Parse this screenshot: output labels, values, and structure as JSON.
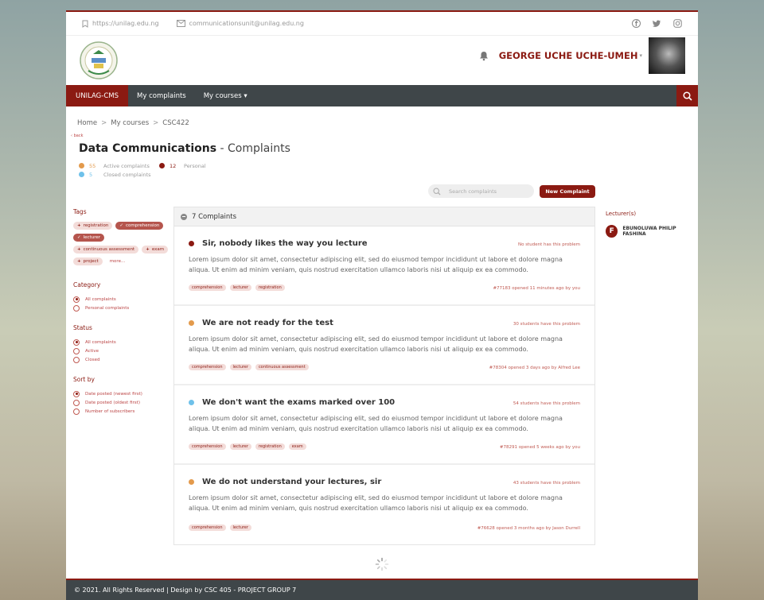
{
  "topbar": {
    "website": "https://unilag.edu.ng",
    "email": "communicationsunit@unilag.edu.ng",
    "social_icons": [
      "facebook-icon",
      "twitter-icon",
      "instagram-icon"
    ]
  },
  "user": {
    "name": "GEORGE UCHE UCHE-UMEH",
    "caret": "▾"
  },
  "nav": {
    "brand": "UNILAG-CMS",
    "links": [
      "My complaints",
      "My courses ▾"
    ]
  },
  "breadcrumb": {
    "items": [
      "Home",
      "My courses",
      "CSC422"
    ],
    "sep": ">"
  },
  "back": "‹ back",
  "page": {
    "course": "Data Communications",
    "section": " - Complaints"
  },
  "stats": {
    "active_count": "55",
    "active_label": "Active complaints",
    "personal_count": "12",
    "personal_label": "Personal",
    "closed_count": "5",
    "closed_label": "Closed complaints"
  },
  "toolbar": {
    "search_placeholder": "Search complaints",
    "new_label": "New Complaint"
  },
  "filters": {
    "tags_title": "Tags",
    "tags": [
      {
        "label": "registration",
        "prefix": "+",
        "active": false
      },
      {
        "label": "comprehension",
        "prefix": "✓",
        "active": true
      },
      {
        "label": "lecturer",
        "prefix": "✓",
        "active": true
      },
      {
        "label": "continuous assessment",
        "prefix": "+",
        "active": false
      },
      {
        "label": "exam",
        "prefix": "+",
        "active": false
      },
      {
        "label": "project",
        "prefix": "+",
        "active": false
      }
    ],
    "more": "more...",
    "category_title": "Category",
    "category": [
      "All complaints",
      "Personal complaints"
    ],
    "status_title": "Status",
    "status": [
      "All complaints",
      "Active",
      "Closed"
    ],
    "sort_title": "Sort by",
    "sort": [
      "Date posted (newest first)",
      "Date posted (oldest first)",
      "Number of subscribers"
    ]
  },
  "list": {
    "count_label": "7 Complaints",
    "items": [
      {
        "title": "Sir, nobody likes the way you lecture",
        "status_color": "#8b1a12",
        "subscribers": "No student has this problem",
        "body": "Lorem ipsum dolor sit amet, consectetur adipiscing elit, sed do eiusmod tempor incididunt ut labore et dolore magna aliqua. Ut enim ad minim veniam, quis nostrud exercitation ullamco laboris nisi ut aliquip ex ea commodo.",
        "tags": [
          "comprehension",
          "lecturer",
          "registration"
        ],
        "meta": "#77183 opened 11 minutes ago by you"
      },
      {
        "title": "We are not ready for the test",
        "status_color": "#e39a4c",
        "subscribers": "30 students have this problem",
        "body": "Lorem ipsum dolor sit amet, consectetur adipiscing elit, sed do eiusmod tempor incididunt ut labore et dolore magna aliqua. Ut enim ad minim veniam, quis nostrud exercitation ullamco laboris nisi ut aliquip ex ea commodo.",
        "tags": [
          "comprehension",
          "lecturer",
          "continuous assessment"
        ],
        "meta": "#78304 opened 3 days ago by Alfred Lee"
      },
      {
        "title": "We don't want the exams marked over 100",
        "status_color": "#6fc1ea",
        "subscribers": "54 students have this problem",
        "body": "Lorem ipsum dolor sit amet, consectetur adipiscing elit, sed do eiusmod tempor incididunt ut labore et dolore magna aliqua. Ut enim ad minim veniam, quis nostrud exercitation ullamco laboris nisi ut aliquip ex ea commodo.",
        "tags": [
          "comprehension",
          "lecturer",
          "registration",
          "exam"
        ],
        "meta": "#78291 opened 5 weeks ago by you"
      },
      {
        "title": "We do not understand your lectures, sir",
        "status_color": "#e39a4c",
        "subscribers": "43 students have this problem",
        "body": "Lorem ipsum dolor sit amet, consectetur adipiscing elit, sed do eiusmod tempor incididunt ut labore et dolore magna aliqua. Ut enim ad minim veniam, quis nostrud exercitation ullamco laboris nisi ut aliquip ex ea commodo.",
        "tags": [
          "comprehension",
          "lecturer"
        ],
        "meta": "#76628 opened 3 months ago by Jason Durrell"
      }
    ]
  },
  "lecturers": {
    "title": "Lecturer(s)",
    "items": [
      {
        "initial": "F",
        "name": "EBUNOLUWA PHILIP FASHINA"
      }
    ]
  },
  "footer": {
    "text": "© 2021. All Rights Reserved | Design by CSC 405 - PROJECT GROUP 7"
  },
  "colors": {
    "brand": "#8b1a12",
    "nav": "#3f4649",
    "active": "#e39a4c",
    "closed": "#6fc1ea"
  }
}
